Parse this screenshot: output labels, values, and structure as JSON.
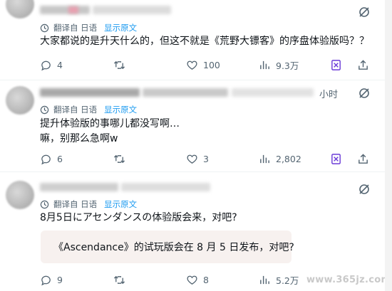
{
  "posts": [
    {
      "translate_label": "翻译自 日语",
      "show_original": "显示原文",
      "lines": [
        "大家都说的是升天什么的，但这不就是《荒野大镖客》的序盘体验版吗？？"
      ],
      "replies": "4",
      "reposts": "",
      "likes": "100",
      "views": "9.3万"
    },
    {
      "time": "小时",
      "translate_label": "翻译自 日语",
      "show_original": "显示原文",
      "lines": [
        "提升体验版的事哪儿都没写啊…",
        "嘛，别那么急啊w"
      ],
      "replies": "6",
      "reposts": "",
      "likes": "3",
      "views": "2,802"
    },
    {
      "translate_label": "翻译自 日语",
      "show_original": "显示原文",
      "lines": [
        "8月5日にアセンダンスの体验版会来，对吧?"
      ],
      "quote": "《Ascendance》的试玩版会在 8 月 5 日发布，对吧?",
      "replies": "9",
      "reposts": "",
      "likes": "8",
      "views": "5.2万"
    }
  ],
  "watermark": "www.365jz.com",
  "icons": {
    "menu": "grok-slash-icon",
    "translate": "translate-icon",
    "reply": "reply-icon",
    "repost": "repost-icon",
    "like": "heart-icon",
    "views": "views-bar-icon",
    "grok": "grok-icon",
    "share": "share-icon"
  },
  "colors": {
    "text": "#0f1419",
    "secondary": "#536471",
    "link": "#1d9bf0",
    "grok": "#6a3ad7",
    "quote_bg": "#f7f1ef"
  }
}
